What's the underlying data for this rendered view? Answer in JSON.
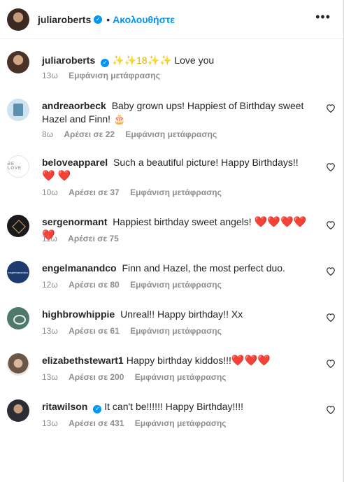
{
  "header": {
    "username": "juliaroberts",
    "separator": "•",
    "follow_label": "Ακολουθήστε",
    "more_label": "•••"
  },
  "caption": {
    "username": "juliaroberts",
    "text_pre": "",
    "sparkles": "✨✨18✨✨",
    "text": "Love you",
    "time": "13ω",
    "translate": "Εμφάνιση μετάφρασης"
  },
  "comments": [
    {
      "username": "andreaorbeck",
      "text": "Baby grown ups! Happiest of Birthday sweet Hazel and Finn!",
      "emoji": "🎂",
      "time": "8ω",
      "likes": "Αρέσει σε 22",
      "translate": "Εμφάνιση μετάφρασης"
    },
    {
      "username": "beloveapparel",
      "text": "Such a beautiful picture! Happy Birthdays!!",
      "emoji": "❤️ ❤️",
      "time": "10ω",
      "likes": "Αρέσει σε 37",
      "translate": "Εμφάνιση μετάφρασης",
      "avatar_text": "BE LOVE"
    },
    {
      "username": "sergenormant",
      "text": "Happiest birthday sweet angels!",
      "emoji": "❤️❤️❤️❤️❤️",
      "time": "11ω",
      "likes": "Αρέσει σε 75",
      "translate": ""
    },
    {
      "username": "engelmanandco",
      "text": "Finn and Hazel, the most perfect duo.",
      "emoji": "",
      "time": "12ω",
      "likes": "Αρέσει σε 80",
      "translate": "Εμφάνιση μετάφρασης",
      "avatar_text": "engelmanandco"
    },
    {
      "username": "highbrowhippie",
      "text": "Unreal!! Happy birthday!! Xx",
      "emoji": "",
      "time": "13ω",
      "likes": "Αρέσει σε 61",
      "translate": "Εμφάνιση μετάφρασης"
    },
    {
      "username": "elizabethstewart1",
      "text": "Happy birthday kiddos!!!",
      "emoji": "❤️❤️❤️",
      "time": "13ω",
      "likes": "Αρέσει σε 200",
      "translate": "Εμφάνιση μετάφρασης"
    },
    {
      "username": "ritawilson",
      "text": "It can't be!!!!!! Happy Birthday!!!!",
      "emoji": "",
      "time": "13ω",
      "likes": "Αρέσει σε 431",
      "translate": "Εμφάνιση μετάφρασης"
    }
  ]
}
